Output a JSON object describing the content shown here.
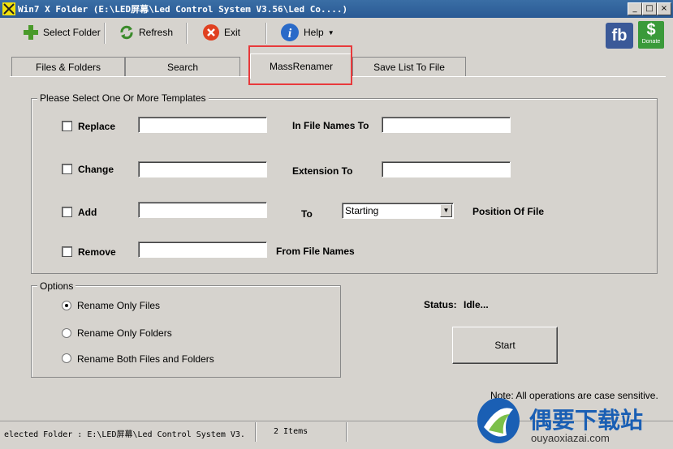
{
  "window": {
    "title": "Win7 X Folder  (E:\\LED屏幕\\Led Control System V3.56\\Led Co....)"
  },
  "toolbar": {
    "select_folder": "Select Folder",
    "refresh": "Refresh",
    "exit": "Exit",
    "help": "Help",
    "fb": "fb",
    "donate": "Donate",
    "dollar": "$"
  },
  "tabs": [
    "Files & Folders",
    "Search",
    "MassRenamer",
    "Save List To File"
  ],
  "templates": {
    "legend": "Please Select One Or More Templates",
    "replace": "Replace",
    "in_file_names_to": "In File Names To",
    "change": "Change",
    "extension_to": "Extension To",
    "add": "Add",
    "to": "To",
    "position_value": "Starting",
    "position_of_file": "Position Of File",
    "remove": "Remove",
    "from_file_names": "From File Names"
  },
  "options": {
    "legend": "Options",
    "items": [
      "Rename Only Files",
      "Rename Only Folders",
      "Rename Both Files and Folders"
    ],
    "selected": 0
  },
  "status": {
    "label": "Status:",
    "value": "Idle..."
  },
  "start_label": "Start",
  "note": "Note: All operations are case sensitive.",
  "statusbar": {
    "folder": "elected Folder : E:\\LED屏幕\\Led Control System V3.",
    "items": "2 Items"
  },
  "watermark": {
    "cn": "偶要下载站",
    "url": "ouyaoxiazai.com"
  },
  "colors": {
    "titlebar": "#2a5a94",
    "highlight": "#e8393b",
    "fb": "#3b5998",
    "donate": "#3a9a3a"
  }
}
